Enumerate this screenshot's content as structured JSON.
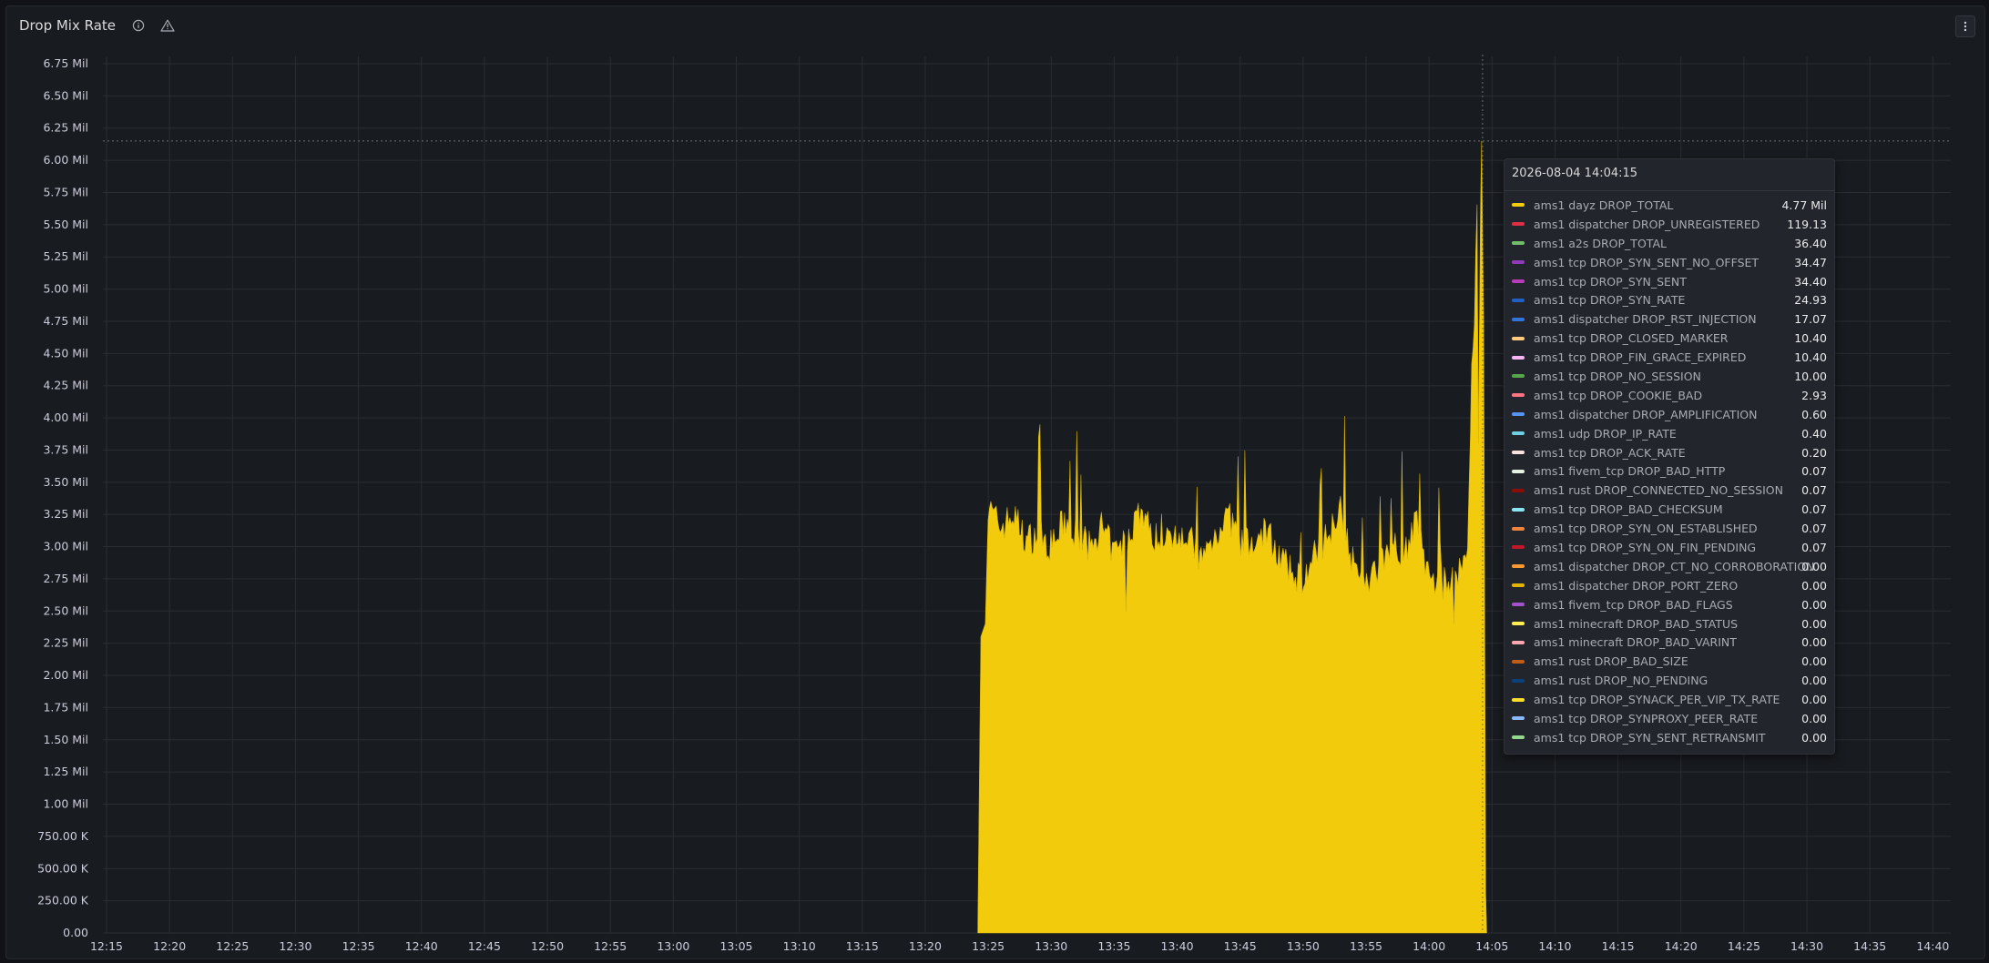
{
  "panel": {
    "title": "Drop Mix Rate",
    "icons": [
      "info-icon",
      "warning-icon"
    ],
    "menu_icon": "kebab-menu-icon"
  },
  "chart_data": {
    "type": "area",
    "title": "Drop Mix Rate",
    "ylim": [
      0,
      6750000
    ],
    "y_ticks": [
      "0.00",
      "250.00 K",
      "500.00 K",
      "750.00 K",
      "1.00 Mil",
      "1.25 Mil",
      "1.50 Mil",
      "1.75 Mil",
      "2.00 Mil",
      "2.25 Mil",
      "2.50 Mil",
      "2.75 Mil",
      "3.00 Mil",
      "3.25 Mil",
      "3.50 Mil",
      "3.75 Mil",
      "4.00 Mil",
      "4.25 Mil",
      "4.50 Mil",
      "4.75 Mil",
      "5.00 Mil",
      "5.25 Mil",
      "5.50 Mil",
      "5.75 Mil",
      "6.00 Mil",
      "6.25 Mil",
      "6.50 Mil",
      "6.75 Mil"
    ],
    "x_ticks": [
      "12:15",
      "12:20",
      "12:25",
      "12:30",
      "12:35",
      "12:40",
      "12:45",
      "12:50",
      "12:55",
      "13:00",
      "13:05",
      "13:10",
      "13:15",
      "13:20",
      "13:25",
      "13:30",
      "13:35",
      "13:40",
      "13:45",
      "13:50",
      "13:55",
      "14:00",
      "14:05",
      "14:10",
      "14:15",
      "14:20",
      "14:25",
      "14:30",
      "14:35",
      "14:40"
    ],
    "x_range": [
      "12:15",
      "14:40"
    ],
    "grid": true,
    "series": [
      {
        "name": "ams1 dayz DROP_TOTAL",
        "color": "#f2cc0c",
        "x": [
          "13:24",
          "13:25",
          "13:26",
          "13:27",
          "13:28",
          "13:29",
          "13:30",
          "13:31",
          "13:32",
          "13:33",
          "13:34",
          "13:35",
          "13:36",
          "13:37",
          "13:38",
          "13:39",
          "13:40",
          "13:41",
          "13:42",
          "13:43",
          "13:44",
          "13:45",
          "13:46",
          "13:47",
          "13:48",
          "13:49",
          "13:50",
          "13:51",
          "13:52",
          "13:53",
          "13:54",
          "13:55",
          "13:56",
          "13:57",
          "13:58",
          "13:59",
          "14:00",
          "14:01",
          "14:02",
          "14:03",
          "14:04"
        ],
        "values": [
          0,
          3300000,
          3150000,
          3250000,
          3050000,
          3100000,
          3000000,
          3200000,
          3100000,
          3000000,
          3150000,
          2950000,
          3050000,
          3300000,
          3100000,
          3000000,
          3150000,
          3050000,
          2900000,
          3100000,
          3250000,
          3050000,
          3000000,
          3150000,
          2950000,
          2800000,
          2750000,
          2950000,
          3100000,
          3350000,
          2850000,
          2700000,
          2850000,
          3050000,
          2950000,
          3200000,
          2750000,
          2700000,
          2800000,
          2900000,
          6150000
        ]
      }
    ],
    "hover_time": "14:04:15"
  },
  "tooltip": {
    "time": "2026-08-04 14:04:15",
    "rows": [
      {
        "name": "ams1 dayz DROP_TOTAL",
        "value": "4.77 Mil",
        "color": "#f2cc0c"
      },
      {
        "name": "ams1 dispatcher DROP_UNREGISTERED",
        "value": "119.13",
        "color": "#e02f44"
      },
      {
        "name": "ams1 a2s DROP_TOTAL",
        "value": "36.40",
        "color": "#73bf69"
      },
      {
        "name": "ams1 tcp DROP_SYN_SENT_NO_OFFSET",
        "value": "34.47",
        "color": "#8f3bb8"
      },
      {
        "name": "ams1 tcp DROP_SYN_SENT",
        "value": "34.40",
        "color": "#b83bb8"
      },
      {
        "name": "ams1 tcp DROP_SYN_RATE",
        "value": "24.93",
        "color": "#1f60c4"
      },
      {
        "name": "ams1 dispatcher DROP_RST_INJECTION",
        "value": "17.07",
        "color": "#3274d9"
      },
      {
        "name": "ams1 tcp DROP_CLOSED_MARKER",
        "value": "10.40",
        "color": "#ffcb7d"
      },
      {
        "name": "ams1 tcp DROP_FIN_GRACE_EXPIRED",
        "value": "10.40",
        "color": "#f4b6f4"
      },
      {
        "name": "ams1 tcp DROP_NO_SESSION",
        "value": "10.00",
        "color": "#56a64b"
      },
      {
        "name": "ams1 tcp DROP_COOKIE_BAD",
        "value": "2.93",
        "color": "#ff7383"
      },
      {
        "name": "ams1 dispatcher DROP_AMPLIFICATION",
        "value": "0.60",
        "color": "#5794f2"
      },
      {
        "name": "ams1 udp DROP_IP_RATE",
        "value": "0.40",
        "color": "#6ed0e0"
      },
      {
        "name": "ams1 tcp DROP_ACK_RATE",
        "value": "0.20",
        "color": "#fce2de"
      },
      {
        "name": "ams1 fivem_tcp DROP_BAD_HTTP",
        "value": "0.07",
        "color": "#e6f3e4"
      },
      {
        "name": "ams1 rust DROP_CONNECTED_NO_SESSION",
        "value": "0.07",
        "color": "#890f02"
      },
      {
        "name": "ams1 tcp DROP_BAD_CHECKSUM",
        "value": "0.07",
        "color": "#8ae5f0"
      },
      {
        "name": "ams1 tcp DROP_SYN_ON_ESTABLISHED",
        "value": "0.07",
        "color": "#ef843c"
      },
      {
        "name": "ams1 tcp DROP_SYN_ON_FIN_PENDING",
        "value": "0.07",
        "color": "#c4162a"
      },
      {
        "name": "ams1 dispatcher DROP_CT_NO_CORROBORATION",
        "value": "0.00",
        "color": "#ff9830"
      },
      {
        "name": "ams1 dispatcher DROP_PORT_ZERO",
        "value": "0.00",
        "color": "#e0b400"
      },
      {
        "name": "ams1 fivem_tcp DROP_BAD_FLAGS",
        "value": "0.00",
        "color": "#a352cc"
      },
      {
        "name": "ams1 minecraft DROP_BAD_STATUS",
        "value": "0.00",
        "color": "#ffee52"
      },
      {
        "name": "ams1 minecraft DROP_BAD_VARINT",
        "value": "0.00",
        "color": "#ffa6b0"
      },
      {
        "name": "ams1 rust DROP_BAD_SIZE",
        "value": "0.00",
        "color": "#c15c17"
      },
      {
        "name": "ams1 rust DROP_NO_PENDING",
        "value": "0.00",
        "color": "#0a437c"
      },
      {
        "name": "ams1 tcp DROP_SYNACK_PER_VIP_TX_RATE",
        "value": "0.00",
        "color": "#fade2a"
      },
      {
        "name": "ams1 tcp DROP_SYNPROXY_PEER_RATE",
        "value": "0.00",
        "color": "#8ab8ff"
      },
      {
        "name": "ams1 tcp DROP_SYN_SENT_RETRANSMIT",
        "value": "0.00",
        "color": "#96d98d"
      }
    ]
  }
}
